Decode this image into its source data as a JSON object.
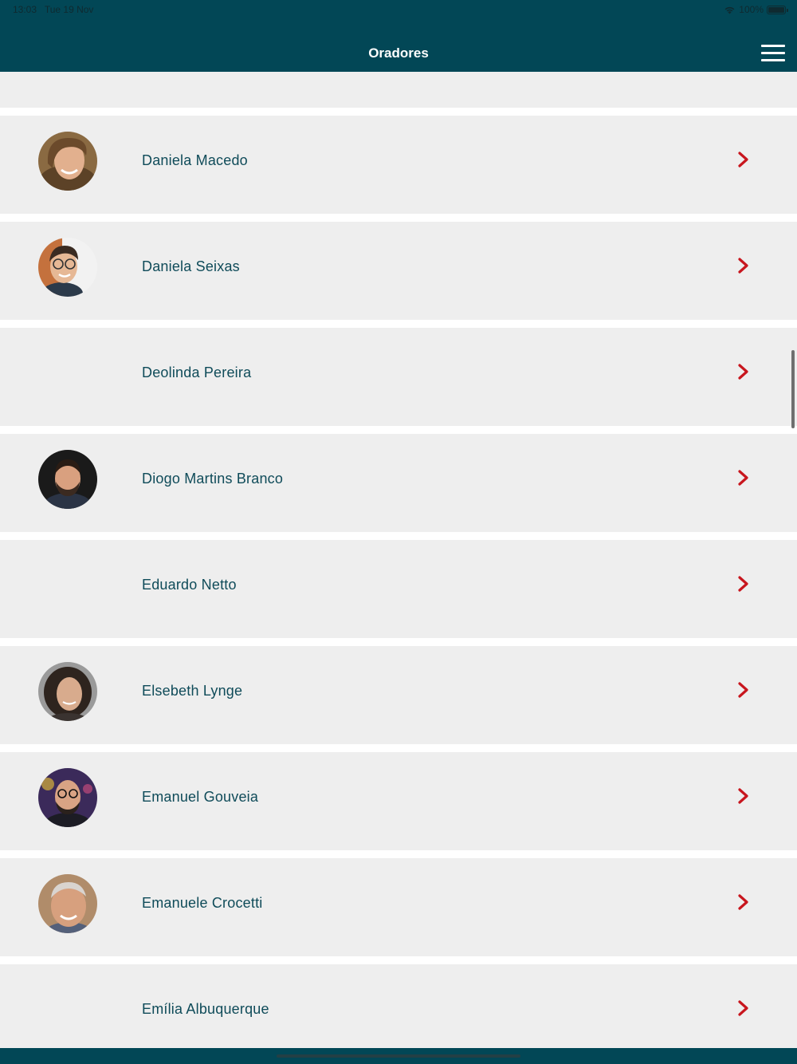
{
  "status_bar": {
    "time": "13:03",
    "date": "Tue 19 Nov",
    "battery": "100%",
    "wifi_icon": "wifi-icon",
    "battery_icon": "battery-icon"
  },
  "header": {
    "title": "Oradores",
    "menu_icon": "hamburger-menu-icon"
  },
  "speakers": [
    {
      "name": "Daniela Macedo",
      "has_photo": true
    },
    {
      "name": "Daniela Seixas",
      "has_photo": true
    },
    {
      "name": "Deolinda Pereira",
      "has_photo": false
    },
    {
      "name": "Diogo Martins Branco",
      "has_photo": true
    },
    {
      "name": "Eduardo Netto",
      "has_photo": false
    },
    {
      "name": "Elsebeth Lynge",
      "has_photo": true
    },
    {
      "name": "Emanuel Gouveia",
      "has_photo": true
    },
    {
      "name": "Emanuele Crocetti",
      "has_photo": true
    },
    {
      "name": "Emília Albuquerque",
      "has_photo": false
    }
  ],
  "row_icon": "chevron-right-icon",
  "colors": {
    "header_bg": "#024756",
    "row_bg": "#eeeeee",
    "name_text": "#0f4b59",
    "chevron": "#c8161e"
  }
}
